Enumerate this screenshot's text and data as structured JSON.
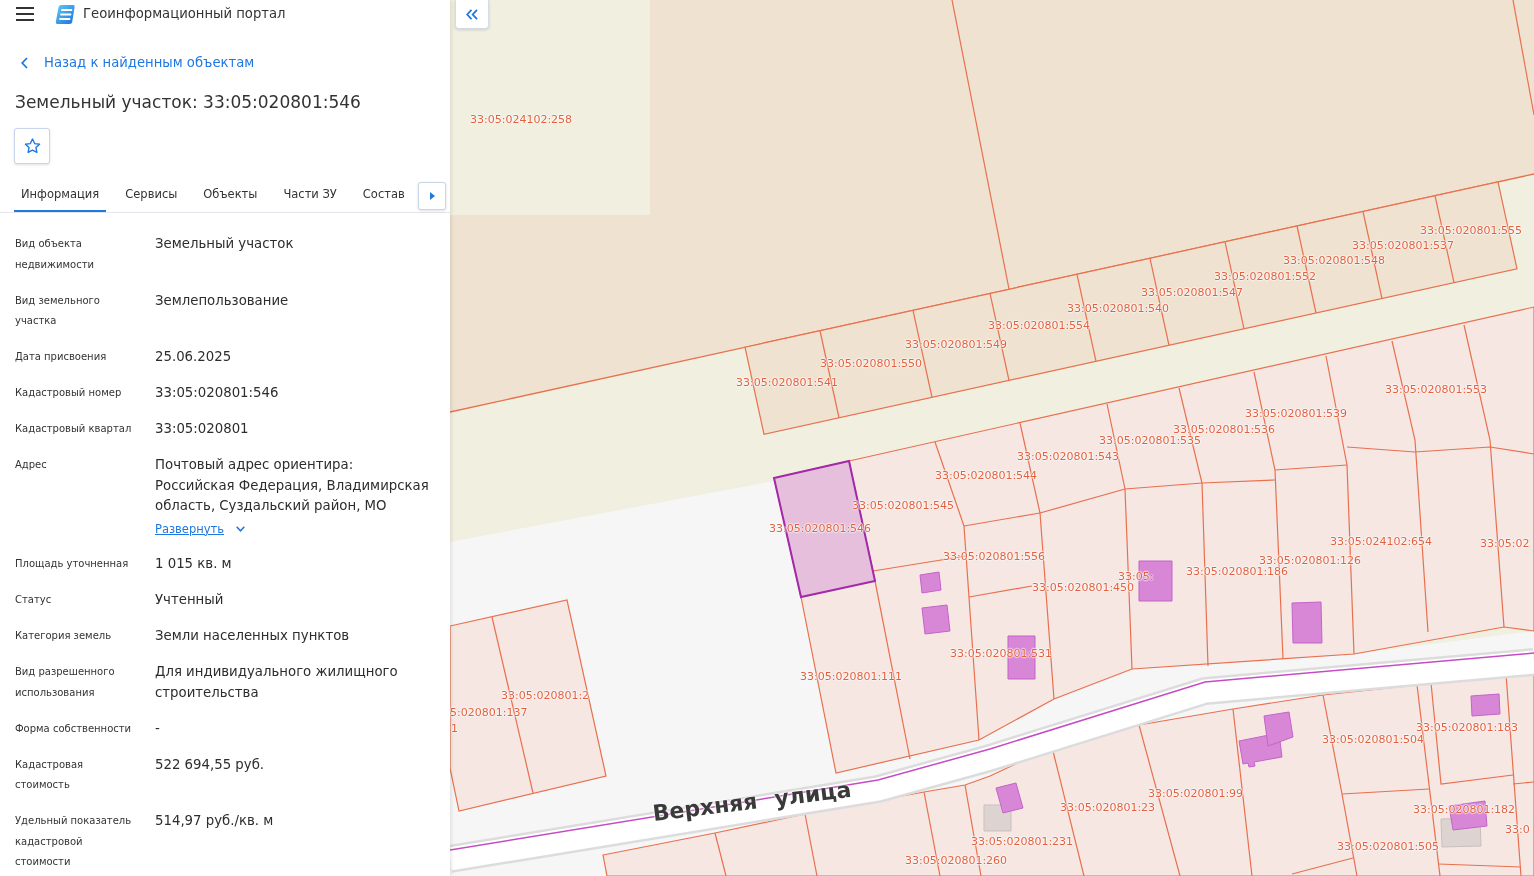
{
  "header": {
    "title": "Геоинформационный портал"
  },
  "back_link": {
    "label": "Назад к найденным объектам"
  },
  "object": {
    "title": "Земельный участок: 33:05:020801:546",
    "starred": false
  },
  "tabs": [
    {
      "label": "Информация",
      "selected": true
    },
    {
      "label": "Сервисы",
      "selected": false
    },
    {
      "label": "Объекты",
      "selected": false
    },
    {
      "label": "Части ЗУ",
      "selected": false
    },
    {
      "label": "Состав",
      "selected": false
    }
  ],
  "fields": [
    {
      "label": "Вид объекта недвижимости",
      "value": "Земельный участок"
    },
    {
      "label": "Вид земельного участка",
      "value": "Землепользование"
    },
    {
      "label": "Дата присвоения",
      "value": "25.06.2025"
    },
    {
      "label": "Кадастровый номер",
      "value": "33:05:020801:546"
    },
    {
      "label": "Кадастровый квартал",
      "value": "33:05:020801"
    },
    {
      "label": "Адрес",
      "value": "Почтовый адрес ориентира: Российская Федерация, Владимирская область, Суздальский район, МО",
      "expand_link": "Развернуть",
      "expanded": false
    },
    {
      "label": "Площадь уточненная",
      "value": "1 015 кв. м"
    },
    {
      "label": "Статус",
      "value": "Учтенный"
    },
    {
      "label": "Категория земель",
      "value": "Земли населенных пунктов"
    },
    {
      "label": "Вид разрешенного использования",
      "value": "Для индивидуального жилищного строительства"
    },
    {
      "label": "Форма собственности",
      "value": "-"
    },
    {
      "label": "Кадастровая стоимость",
      "value": "522 694,55 руб."
    },
    {
      "label": "Удельный показатель кадастровой стоимости",
      "value": "514,97 руб./кв. м"
    }
  ],
  "map": {
    "parcel_labels": [
      "33:05:024102:258",
      "33:05:020801:555",
      "33:05:020801:537",
      "33:05:020801:548",
      "33:05:020801:552",
      "33:05:020801:547",
      "33:05:020801:540",
      "33:05:020801:554",
      "33:05:020801:549",
      "33:05:020801:550",
      "33:05:020801:541",
      "33:05:020801:553",
      "33:05:020801:539",
      "33:05:020801:536",
      "33:05:020801:535",
      "33:05:020801:543",
      "33:05:020801:544",
      "33:05:020801:545",
      "33:05:020801:546",
      "33:05:024102:654",
      "33:05:02",
      "33:05:020801:126",
      "33:05:020801:556",
      "33:05:020801:186",
      "33:05:",
      "33:05:020801:450",
      "33:05:020801:531",
      "33:05:020801:111",
      "33:05:020801:2",
      "5:020801:137",
      "1",
      "33:05:020801:183",
      "33:05:020801:504",
      "33:05:020801:99",
      "33:05:020801:23",
      "33:05:020801:182",
      "33:0",
      "33:05:020801:231",
      "33:05:020801:505",
      "33:05:020801:260"
    ],
    "street_label": "Верхняя улица"
  }
}
